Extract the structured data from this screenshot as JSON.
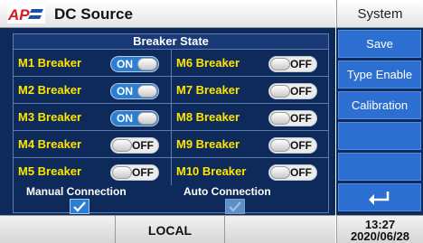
{
  "header": {
    "title": "DC Source",
    "system_tab": "System"
  },
  "logo": {
    "text": "AP"
  },
  "panel": {
    "title": "Breaker State",
    "rows": [
      {
        "left": {
          "label": "M1 Breaker",
          "state": "ON"
        },
        "right": {
          "label": "M6 Breaker",
          "state": "OFF"
        }
      },
      {
        "left": {
          "label": "M2 Breaker",
          "state": "ON"
        },
        "right": {
          "label": "M7 Breaker",
          "state": "OFF"
        }
      },
      {
        "left": {
          "label": "M3 Breaker",
          "state": "ON"
        },
        "right": {
          "label": "M8 Breaker",
          "state": "OFF"
        }
      },
      {
        "left": {
          "label": "M4 Breaker",
          "state": "OFF"
        },
        "right": {
          "label": "M9 Breaker",
          "state": "OFF"
        }
      },
      {
        "left": {
          "label": "M5 Breaker",
          "state": "OFF"
        },
        "right": {
          "label": "M10 Breaker",
          "state": "OFF"
        }
      }
    ],
    "manual_connection": {
      "label": "Manual Connection",
      "checked": true
    },
    "auto_connection": {
      "label": "Auto Connection",
      "checked": true
    }
  },
  "side_menu": {
    "save": "Save",
    "type_enable": "Type Enable",
    "calibration": "Calibration",
    "back_icon": "return-arrow-icon"
  },
  "footer": {
    "mode": "LOCAL",
    "time": "13:27",
    "date": "2020/06/28"
  },
  "colors": {
    "panel_bg": "#0e2a5a",
    "label_yellow": "#ffe500",
    "button_blue": "#2d6fd0",
    "toggle_on": "#2a7fd4"
  }
}
